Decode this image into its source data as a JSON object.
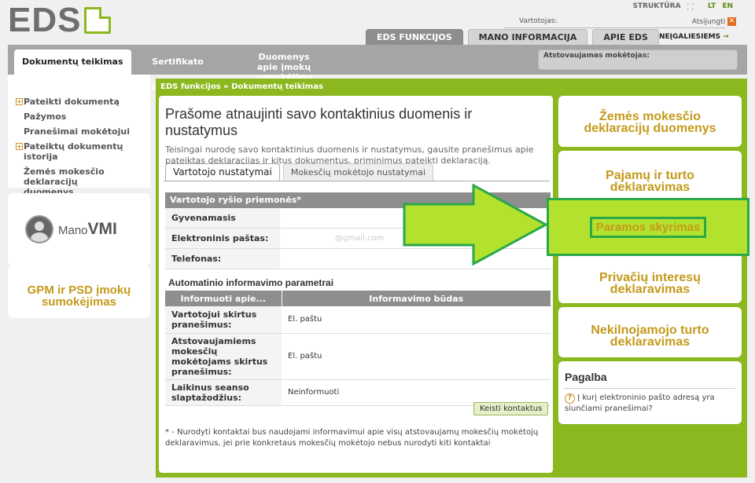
{
  "header": {
    "logo_text": "EDS",
    "struktura": "STRUKTŪRA",
    "lang_lt": "LT",
    "lang_en": "EN",
    "user_label": "Vartotojas:",
    "logout": "Atsijungti",
    "neigaliesiems": "NEĮGALIESIEMS",
    "tabs": [
      "EDS FUNKCIJOS",
      "MANO INFORMACIJA",
      "APIE EDS"
    ]
  },
  "navbar": {
    "tabs": [
      "Dokumentų teikimas",
      "Sertifikato deklaravimas",
      "Duomenys",
      "apie įmokų sumokėjimą"
    ],
    "representative_label": "Atstovaujamas mokėtojas:"
  },
  "sidebar": {
    "items": [
      "Pateikti dokumentą",
      "Pažymos",
      "Pranešimai mokėtojui",
      "Pateiktų dokumentų istorija",
      "Žemės mokesčio deklaracijų",
      "duomenys"
    ],
    "mano_1": "Mano",
    "mano_2": "VMI",
    "gpm_1": "GPM ir PSD įmokų",
    "gpm_2": "sumokėjimas"
  },
  "main": {
    "breadcrumb": "EDS funkcijos » Dokumentų teikimas",
    "title": "Prašome atnaujinti savo kontaktinius duomenis ir nustatymus",
    "intro": "Teisingai nurodę savo kontaktinius duomenis ir nustatymus, gausite pranešimus apie pateiktas deklaracijas ir kitus dokumentus, priminimus pateikti deklaraciją.",
    "tabs": [
      "Vartotojo nustatymai",
      "Mokesčių mokėtojo nustatymai"
    ],
    "contact_header": "Vartotojo ryšio priemonės*",
    "fields": [
      {
        "label": "Gyvenamasis adresas:",
        "value": ""
      },
      {
        "label": "Elektroninis paštas:",
        "value": "@gmail.com"
      },
      {
        "label": "Telefonas:",
        "value": ""
      }
    ],
    "auto_title": "Automatinio informavimo parametrai",
    "table_headers": [
      "Informuoti apie...",
      "Informavimo būdas"
    ],
    "table_rows": [
      [
        "Vartotojui skirtus pranešimus:",
        "El. paštu"
      ],
      [
        "Atstovaujamiems mokesčių mokėtojams skirtus pranešimus:",
        "El. paštu"
      ],
      [
        "Laikinus seanso slaptažodžius:",
        "Neinformuoti"
      ]
    ],
    "button": "Keisti kontaktus",
    "footnote": "* - Nurodyti kontaktai bus naudojami informavimui apie visų atstovaujamų mokesčių mokėtojų deklaravimus, jei prie konkretaus mokesčių mokėtojo nebus nurodyti kiti kontaktai"
  },
  "right": {
    "boxes": [
      [
        "Žemės mokesčio",
        "deklaracijų duomenys"
      ],
      [
        "Pajamų ir turto",
        "deklaravimas"
      ],
      [
        "Paramos skyrimas"
      ],
      [
        "Privačių interesų",
        "deklaravimas"
      ],
      [
        "Nekilnojamojo turto",
        "deklaravimas"
      ]
    ],
    "help_title": "Pagalba",
    "help_text": "Į kurį elektroninio pašto adresą yra siunčiami pranešimai?"
  },
  "colors": {
    "brand_green": "#8cb81f",
    "highlight": "#b3e22e",
    "gold": "#c49a1a"
  }
}
